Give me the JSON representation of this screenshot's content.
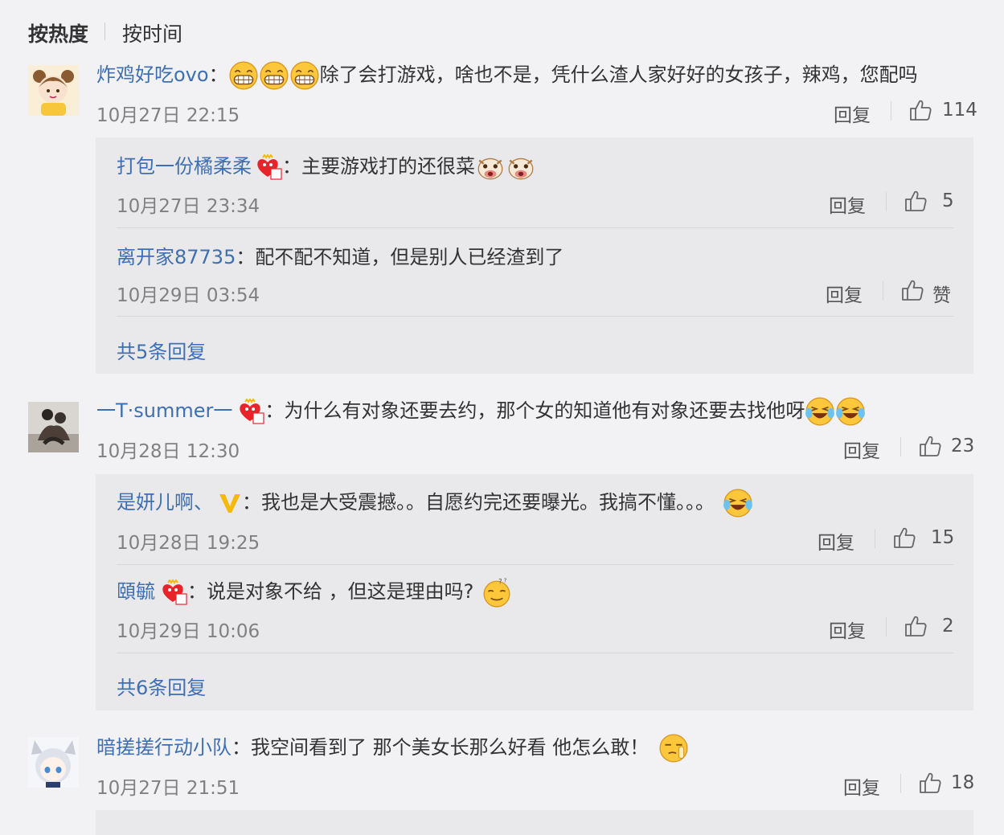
{
  "sort": {
    "hot": "按热度",
    "time": "按时间"
  },
  "comments": [
    {
      "user": "炸鸡好吃ovo",
      "text": "除了会打游戏，啥也不是，凭什么渣人家好好的女孩子，辣鸡，您配吗",
      "time": "10月27日 22:15",
      "reply_label": "回复",
      "likes": "114",
      "replies": [
        {
          "user": "打包一份橘柔柔",
          "text": "主要游戏打的还很菜",
          "time": "10月27日 23:34",
          "reply_label": "回复",
          "likes": "5"
        },
        {
          "user": "离开家87735",
          "text": "配不配不知道，但是别人已经渣到了",
          "time": "10月29日 03:54",
          "reply_label": "回复",
          "likes": "赞"
        }
      ],
      "more": "共5条回复"
    },
    {
      "user": "一T·summer一",
      "text": "为什么有对象还要去约，那个女的知道他有对象还要去找他呀",
      "time": "10月28日 12:30",
      "reply_label": "回复",
      "likes": "23",
      "replies": [
        {
          "user": "是妍儿啊、",
          "text": "我也是大受震撼。。自愿约完还要曝光。我搞不懂。。。",
          "time": "10月28日 19:25",
          "reply_label": "回复",
          "likes": "15"
        },
        {
          "user": "頤毓",
          "text": "说是对象不给 ，但这是理由吗?",
          "time": "10月29日 10:06",
          "reply_label": "回复",
          "likes": "2"
        }
      ],
      "more": "共6条回复"
    },
    {
      "user": "暗搓搓行动小队",
      "text": "我空间看到了 那个美女长那么好看 他怎么敢！",
      "time": "10月27日 21:51",
      "reply_label": "回复",
      "likes": "18",
      "replies": []
    }
  ],
  "colors": {
    "link": "#3d6fb2",
    "bg": "#f2f2f5",
    "reply_bg": "#e9e9ec",
    "badge_red": "#e8242b",
    "badge_gold": "#f5b80c",
    "emoji_yellow": "#fcc73a"
  }
}
